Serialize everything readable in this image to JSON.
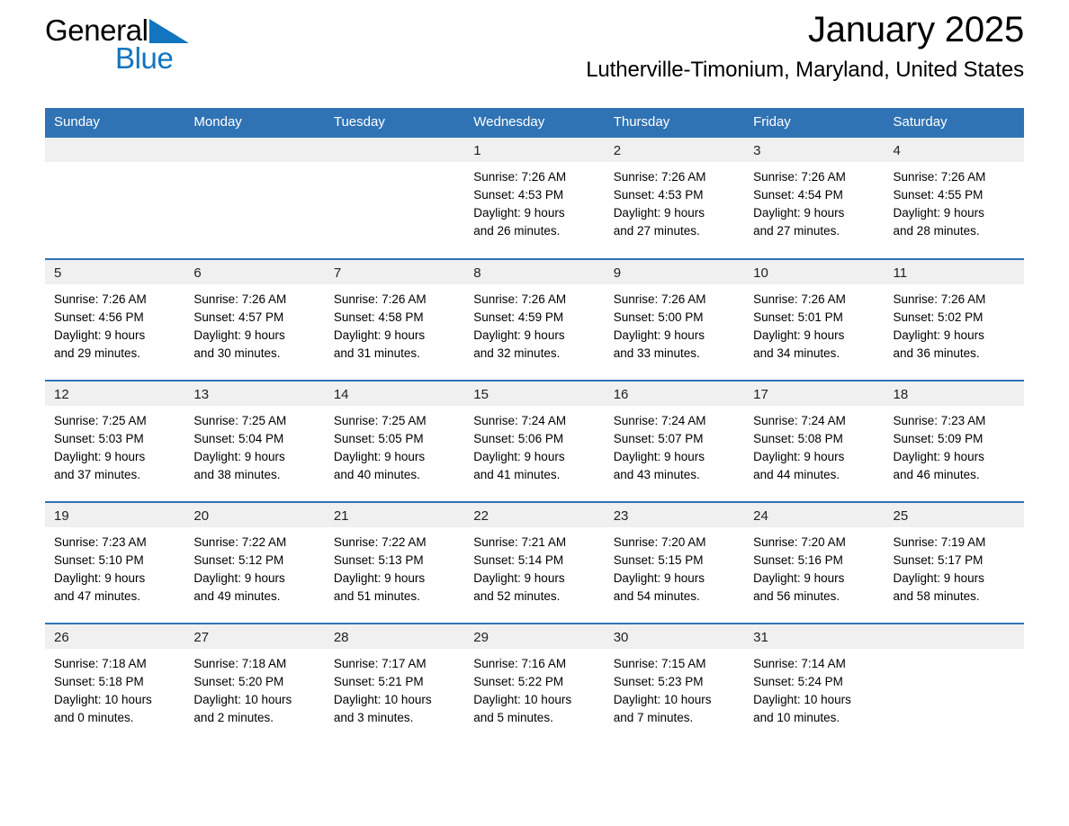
{
  "brand": {
    "name_dark": "General",
    "name_light": "Blue",
    "flag_icon": "blue-triangle-flag-icon",
    "accent_color": "#1175bf"
  },
  "header": {
    "title": "January 2025",
    "location": "Lutherville-Timonium, Maryland, United States"
  },
  "colors": {
    "header_blue": "#3073b4",
    "daynum_band": "#f0f0f0",
    "brand_blue": "#1175bf",
    "page_background": "#ffffff"
  },
  "calendar": {
    "weekday_headers": [
      "Sunday",
      "Monday",
      "Tuesday",
      "Wednesday",
      "Thursday",
      "Friday",
      "Saturday"
    ],
    "weeks": [
      [
        {
          "day": "",
          "sunrise": "",
          "sunset": "",
          "daylight_line1": "",
          "daylight_line2": ""
        },
        {
          "day": "",
          "sunrise": "",
          "sunset": "",
          "daylight_line1": "",
          "daylight_line2": ""
        },
        {
          "day": "",
          "sunrise": "",
          "sunset": "",
          "daylight_line1": "",
          "daylight_line2": ""
        },
        {
          "day": "1",
          "sunrise": "Sunrise: 7:26 AM",
          "sunset": "Sunset: 4:53 PM",
          "daylight_line1": "Daylight: 9 hours",
          "daylight_line2": "and 26 minutes."
        },
        {
          "day": "2",
          "sunrise": "Sunrise: 7:26 AM",
          "sunset": "Sunset: 4:53 PM",
          "daylight_line1": "Daylight: 9 hours",
          "daylight_line2": "and 27 minutes."
        },
        {
          "day": "3",
          "sunrise": "Sunrise: 7:26 AM",
          "sunset": "Sunset: 4:54 PM",
          "daylight_line1": "Daylight: 9 hours",
          "daylight_line2": "and 27 minutes."
        },
        {
          "day": "4",
          "sunrise": "Sunrise: 7:26 AM",
          "sunset": "Sunset: 4:55 PM",
          "daylight_line1": "Daylight: 9 hours",
          "daylight_line2": "and 28 minutes."
        }
      ],
      [
        {
          "day": "5",
          "sunrise": "Sunrise: 7:26 AM",
          "sunset": "Sunset: 4:56 PM",
          "daylight_line1": "Daylight: 9 hours",
          "daylight_line2": "and 29 minutes."
        },
        {
          "day": "6",
          "sunrise": "Sunrise: 7:26 AM",
          "sunset": "Sunset: 4:57 PM",
          "daylight_line1": "Daylight: 9 hours",
          "daylight_line2": "and 30 minutes."
        },
        {
          "day": "7",
          "sunrise": "Sunrise: 7:26 AM",
          "sunset": "Sunset: 4:58 PM",
          "daylight_line1": "Daylight: 9 hours",
          "daylight_line2": "and 31 minutes."
        },
        {
          "day": "8",
          "sunrise": "Sunrise: 7:26 AM",
          "sunset": "Sunset: 4:59 PM",
          "daylight_line1": "Daylight: 9 hours",
          "daylight_line2": "and 32 minutes."
        },
        {
          "day": "9",
          "sunrise": "Sunrise: 7:26 AM",
          "sunset": "Sunset: 5:00 PM",
          "daylight_line1": "Daylight: 9 hours",
          "daylight_line2": "and 33 minutes."
        },
        {
          "day": "10",
          "sunrise": "Sunrise: 7:26 AM",
          "sunset": "Sunset: 5:01 PM",
          "daylight_line1": "Daylight: 9 hours",
          "daylight_line2": "and 34 minutes."
        },
        {
          "day": "11",
          "sunrise": "Sunrise: 7:26 AM",
          "sunset": "Sunset: 5:02 PM",
          "daylight_line1": "Daylight: 9 hours",
          "daylight_line2": "and 36 minutes."
        }
      ],
      [
        {
          "day": "12",
          "sunrise": "Sunrise: 7:25 AM",
          "sunset": "Sunset: 5:03 PM",
          "daylight_line1": "Daylight: 9 hours",
          "daylight_line2": "and 37 minutes."
        },
        {
          "day": "13",
          "sunrise": "Sunrise: 7:25 AM",
          "sunset": "Sunset: 5:04 PM",
          "daylight_line1": "Daylight: 9 hours",
          "daylight_line2": "and 38 minutes."
        },
        {
          "day": "14",
          "sunrise": "Sunrise: 7:25 AM",
          "sunset": "Sunset: 5:05 PM",
          "daylight_line1": "Daylight: 9 hours",
          "daylight_line2": "and 40 minutes."
        },
        {
          "day": "15",
          "sunrise": "Sunrise: 7:24 AM",
          "sunset": "Sunset: 5:06 PM",
          "daylight_line1": "Daylight: 9 hours",
          "daylight_line2": "and 41 minutes."
        },
        {
          "day": "16",
          "sunrise": "Sunrise: 7:24 AM",
          "sunset": "Sunset: 5:07 PM",
          "daylight_line1": "Daylight: 9 hours",
          "daylight_line2": "and 43 minutes."
        },
        {
          "day": "17",
          "sunrise": "Sunrise: 7:24 AM",
          "sunset": "Sunset: 5:08 PM",
          "daylight_line1": "Daylight: 9 hours",
          "daylight_line2": "and 44 minutes."
        },
        {
          "day": "18",
          "sunrise": "Sunrise: 7:23 AM",
          "sunset": "Sunset: 5:09 PM",
          "daylight_line1": "Daylight: 9 hours",
          "daylight_line2": "and 46 minutes."
        }
      ],
      [
        {
          "day": "19",
          "sunrise": "Sunrise: 7:23 AM",
          "sunset": "Sunset: 5:10 PM",
          "daylight_line1": "Daylight: 9 hours",
          "daylight_line2": "and 47 minutes."
        },
        {
          "day": "20",
          "sunrise": "Sunrise: 7:22 AM",
          "sunset": "Sunset: 5:12 PM",
          "daylight_line1": "Daylight: 9 hours",
          "daylight_line2": "and 49 minutes."
        },
        {
          "day": "21",
          "sunrise": "Sunrise: 7:22 AM",
          "sunset": "Sunset: 5:13 PM",
          "daylight_line1": "Daylight: 9 hours",
          "daylight_line2": "and 51 minutes."
        },
        {
          "day": "22",
          "sunrise": "Sunrise: 7:21 AM",
          "sunset": "Sunset: 5:14 PM",
          "daylight_line1": "Daylight: 9 hours",
          "daylight_line2": "and 52 minutes."
        },
        {
          "day": "23",
          "sunrise": "Sunrise: 7:20 AM",
          "sunset": "Sunset: 5:15 PM",
          "daylight_line1": "Daylight: 9 hours",
          "daylight_line2": "and 54 minutes."
        },
        {
          "day": "24",
          "sunrise": "Sunrise: 7:20 AM",
          "sunset": "Sunset: 5:16 PM",
          "daylight_line1": "Daylight: 9 hours",
          "daylight_line2": "and 56 minutes."
        },
        {
          "day": "25",
          "sunrise": "Sunrise: 7:19 AM",
          "sunset": "Sunset: 5:17 PM",
          "daylight_line1": "Daylight: 9 hours",
          "daylight_line2": "and 58 minutes."
        }
      ],
      [
        {
          "day": "26",
          "sunrise": "Sunrise: 7:18 AM",
          "sunset": "Sunset: 5:18 PM",
          "daylight_line1": "Daylight: 10 hours",
          "daylight_line2": "and 0 minutes."
        },
        {
          "day": "27",
          "sunrise": "Sunrise: 7:18 AM",
          "sunset": "Sunset: 5:20 PM",
          "daylight_line1": "Daylight: 10 hours",
          "daylight_line2": "and 2 minutes."
        },
        {
          "day": "28",
          "sunrise": "Sunrise: 7:17 AM",
          "sunset": "Sunset: 5:21 PM",
          "daylight_line1": "Daylight: 10 hours",
          "daylight_line2": "and 3 minutes."
        },
        {
          "day": "29",
          "sunrise": "Sunrise: 7:16 AM",
          "sunset": "Sunset: 5:22 PM",
          "daylight_line1": "Daylight: 10 hours",
          "daylight_line2": "and 5 minutes."
        },
        {
          "day": "30",
          "sunrise": "Sunrise: 7:15 AM",
          "sunset": "Sunset: 5:23 PM",
          "daylight_line1": "Daylight: 10 hours",
          "daylight_line2": "and 7 minutes."
        },
        {
          "day": "31",
          "sunrise": "Sunrise: 7:14 AM",
          "sunset": "Sunset: 5:24 PM",
          "daylight_line1": "Daylight: 10 hours",
          "daylight_line2": "and 10 minutes."
        },
        {
          "day": "",
          "sunrise": "",
          "sunset": "",
          "daylight_line1": "",
          "daylight_line2": ""
        }
      ]
    ]
  }
}
